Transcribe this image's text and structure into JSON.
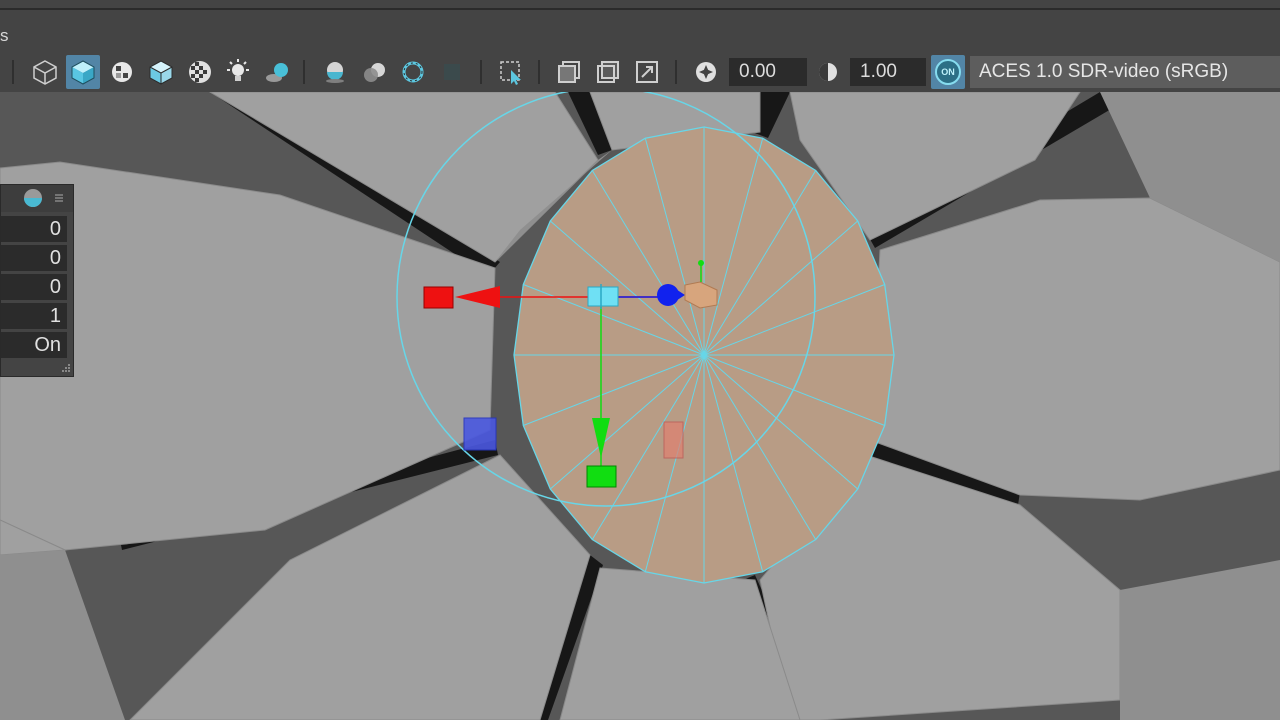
{
  "toolbar": {
    "label_fragment": "s",
    "icons": [
      "wireframe-cube-icon",
      "shaded-cube-icon",
      "textured-icon",
      "wireframe-on-shaded-icon",
      "checker-icon",
      "light-icon",
      "shadow-icon",
      "ambient-occlusion-icon",
      "motion-blur-icon",
      "anti-aliasing-icon",
      "depth-of-field-icon",
      "isolate-select-icon",
      "xray-icon",
      "xray-joints-icon",
      "xray-active-icon",
      "exposure-icon",
      "gamma-icon",
      "color-management-icon"
    ],
    "exposure_value": "0.00",
    "gamma_value": "1.00",
    "color_management_toggle": "ON",
    "color_space": "ACES 1.0 SDR-video (sRGB)"
  },
  "attribute_panel": {
    "rows": [
      "0",
      "0",
      "0",
      "1",
      "On"
    ]
  },
  "colors": {
    "toolbar_bg": "#444444",
    "active_button": "#5285a6",
    "selection_cyan": "#67d6e8",
    "face_fill": "#b89c85",
    "manip_red": "#ee1111",
    "manip_green": "#11dd11",
    "manip_blue": "#1122ee"
  }
}
